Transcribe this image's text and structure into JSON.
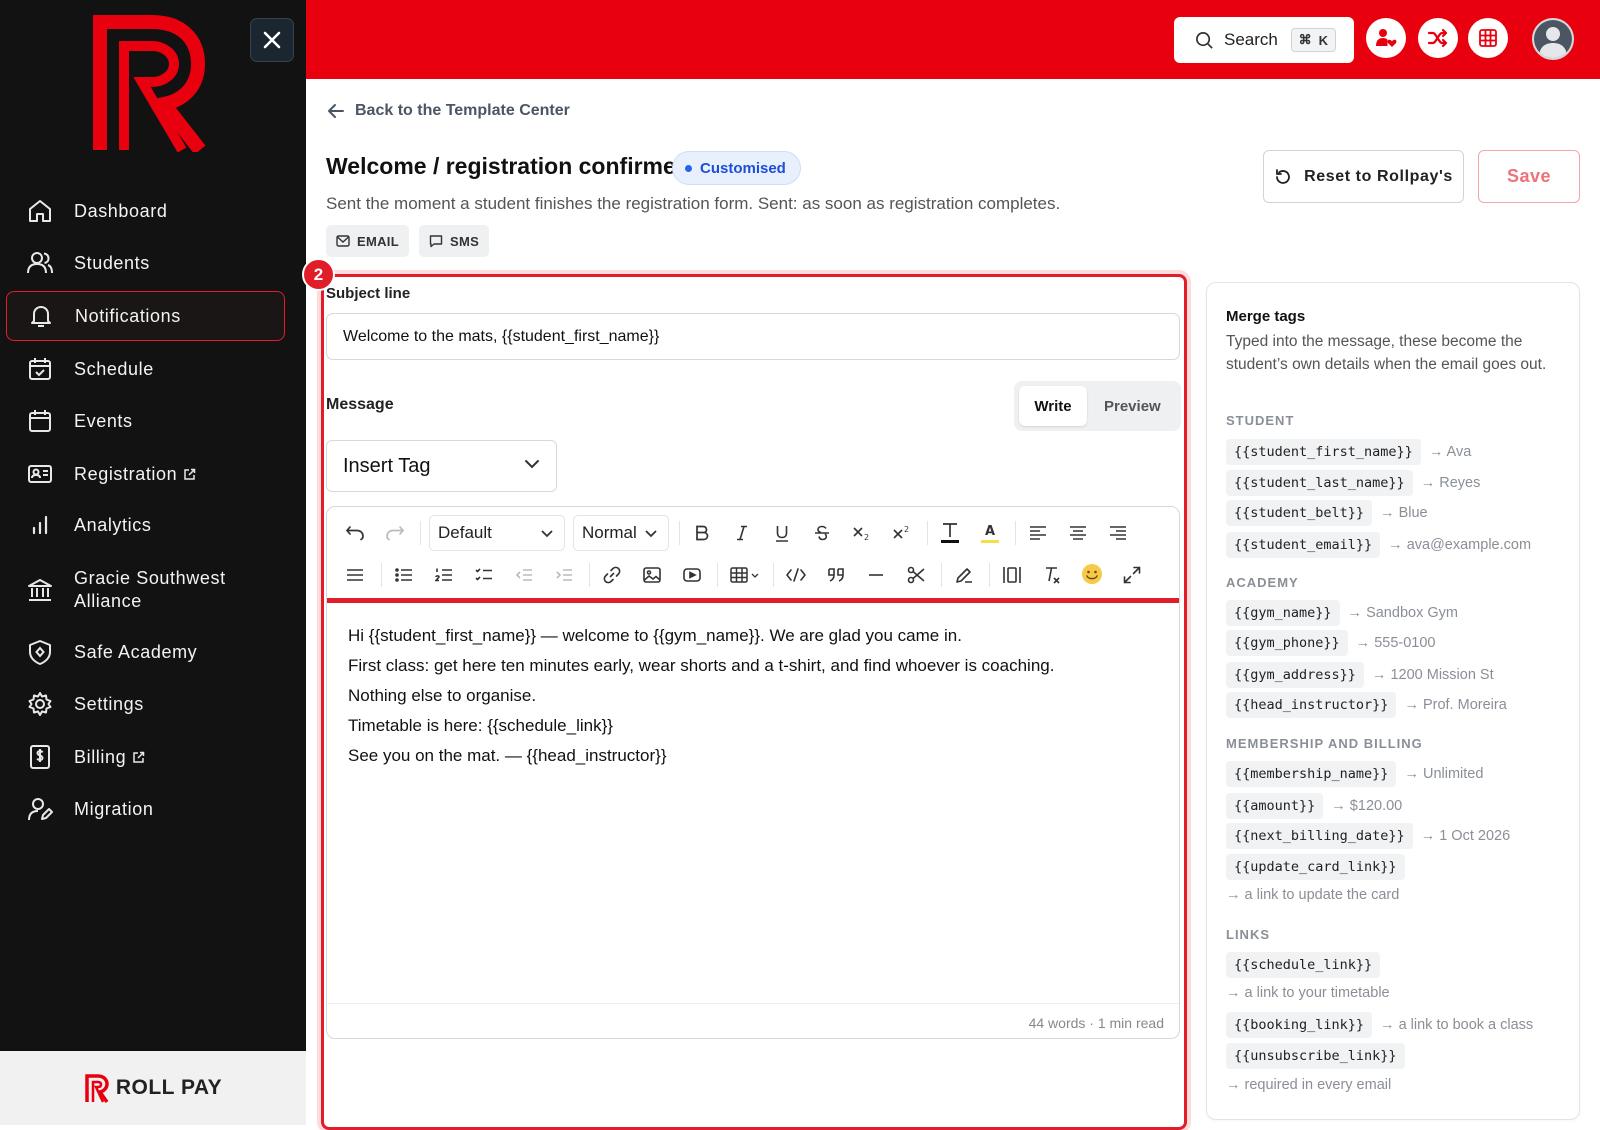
{
  "sidebar": {
    "brand": "ROLL PAY",
    "items": [
      {
        "label": "Dashboard",
        "icon": "home-icon"
      },
      {
        "label": "Students",
        "icon": "users-icon"
      },
      {
        "label": "Notifications",
        "icon": "bell-icon",
        "active": true
      },
      {
        "label": "Schedule",
        "icon": "calendar-check-icon"
      },
      {
        "label": "Events",
        "icon": "calendar-icon"
      },
      {
        "label": "Registration",
        "icon": "id-card-icon",
        "external": true
      },
      {
        "label": "Analytics",
        "icon": "bar-chart-icon"
      },
      {
        "label": "Gracie Southwest",
        "label2": "Alliance",
        "icon": "bank-icon"
      },
      {
        "label": "Safe Academy",
        "icon": "shield-icon"
      },
      {
        "label": "Settings",
        "icon": "gear-icon"
      },
      {
        "label": "Billing",
        "icon": "receipt-icon",
        "external": true
      },
      {
        "label": "Migration",
        "icon": "user-edit-icon"
      }
    ]
  },
  "topbar": {
    "search_label": "Search",
    "shortcut_mod": "⌘",
    "shortcut_key": "K",
    "accent_color": "#e8000f"
  },
  "page": {
    "back_label": "Back to the Template Center",
    "title": "Welcome / registration confirmed",
    "status_badge": "Customised",
    "subtitle": "Sent the moment a student finishes the registration form. Sent: as soon as registration completes.",
    "channels": [
      "EMAIL",
      "SMS"
    ],
    "reset_label": "Reset to Rollpay's",
    "save_label": "Save"
  },
  "editor": {
    "step_number": "2",
    "subject_label": "Subject line",
    "subject_value": "Welcome to the mats, {{student_first_name}}",
    "message_label": "Message",
    "write_tab": "Write",
    "preview_tab": "Preview",
    "insert_tag_label": "Insert Tag",
    "font_select": "Default",
    "size_select": "Normal",
    "body_lines": [
      "Hi {{student_first_name}} — welcome to {{gym_name}}. We are glad you came in.",
      "First class: get here ten minutes early, wear shorts and a t-shirt, and find whoever is coaching.",
      "Nothing else to organise.",
      "Timetable is here: {{schedule_link}}",
      "See you on the mat. — {{head_instructor}}"
    ],
    "word_count": "44 words · 1 min read"
  },
  "merge_tags": {
    "title": "Merge tags",
    "description": "Typed into the message, these become the student’s own details when the email goes out.",
    "sections": {
      "student": {
        "name": "STUDENT",
        "tags": [
          {
            "tag": "{{student_first_name}}",
            "preview": "→ Ava"
          },
          {
            "tag": "{{student_last_name}}",
            "preview": "→ Reyes"
          },
          {
            "tag": "{{student_belt}}",
            "preview": "→ Blue"
          },
          {
            "tag": "{{student_email}}",
            "preview": "→ ava@example.com"
          }
        ]
      },
      "academy": {
        "name": "ACADEMY",
        "tags": [
          {
            "tag": "{{gym_name}}",
            "preview": "→ Sandbox Gym"
          },
          {
            "tag": "{{gym_phone}}",
            "preview": "→ 555-0100"
          },
          {
            "tag": "{{gym_address}}",
            "preview": "→ 1200 Mission St"
          },
          {
            "tag": "{{head_instructor}}",
            "preview": "→ Prof. Moreira"
          }
        ]
      },
      "billing": {
        "name": "MEMBERSHIP AND BILLING",
        "tags": [
          {
            "tag": "{{membership_name}}",
            "preview": "→ Unlimited"
          },
          {
            "tag": "{{amount}}",
            "preview": "→ $120.00"
          },
          {
            "tag": "{{next_billing_date}}",
            "preview": "→ 1 Oct 2026"
          },
          {
            "tag": "{{update_card_link}}",
            "preview": "→ a link to update the card"
          }
        ]
      },
      "links": {
        "name": "LINKS",
        "tags": [
          {
            "tag": "{{schedule_link}}",
            "preview": "→ a link to your timetable"
          },
          {
            "tag": "{{booking_link}}",
            "preview": "→ a link to book a class"
          },
          {
            "tag": "{{unsubscribe_link}}",
            "preview": "→ required in every email"
          }
        ]
      }
    }
  }
}
